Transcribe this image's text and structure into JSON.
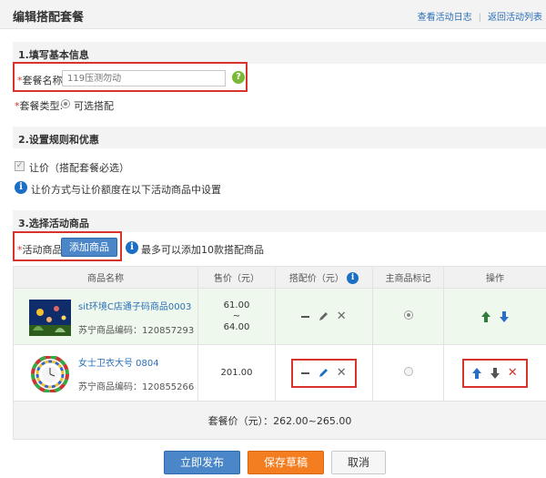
{
  "header": {
    "title": "编辑搭配套餐",
    "links": [
      "查看活动日志",
      "返回活动列表"
    ]
  },
  "section1": {
    "title": "1.填写基本信息",
    "name_label": "套餐名称:",
    "name_placeholder": "119压测勿动",
    "type_label": "套餐类型:",
    "type_value": "可选搭配",
    "required_mark": "*"
  },
  "section2": {
    "title": "2.设置规则和优惠",
    "checkbox_label": "让价（搭配套餐必选）",
    "info_text": "让价方式与让价额度在以下活动商品中设置"
  },
  "section3": {
    "title": "3.选择活动商品",
    "products_label": "活动商品:",
    "add_button": "添加商品",
    "limit_text": "最多可以添加10款搭配商品"
  },
  "table": {
    "headers": [
      "商品名称",
      "售价（元）",
      "搭配价（元）",
      "主商品标记",
      "操作"
    ],
    "rows": [
      {
        "name": "sit环境C店通子码商品0003",
        "code": "苏宁商品编码：120857293",
        "price_low": "61.00",
        "price_sep": "~",
        "price_high": "64.00",
        "is_main": true
      },
      {
        "name": "女士卫衣大号 0804",
        "code": "苏宁商品编码：120855266",
        "price": "201.00",
        "is_main": false
      }
    ],
    "total": "套餐价（元）：262.00~265.00"
  },
  "footer": {
    "publish": "立即发布",
    "save_draft": "保存草稿",
    "cancel": "取消"
  },
  "colors": {
    "accent_blue": "#4a86c8",
    "link_blue": "#2a6fb7",
    "orange": "#f47d1f",
    "highlight_red": "#d9342b",
    "help_green": "#7ab836"
  }
}
